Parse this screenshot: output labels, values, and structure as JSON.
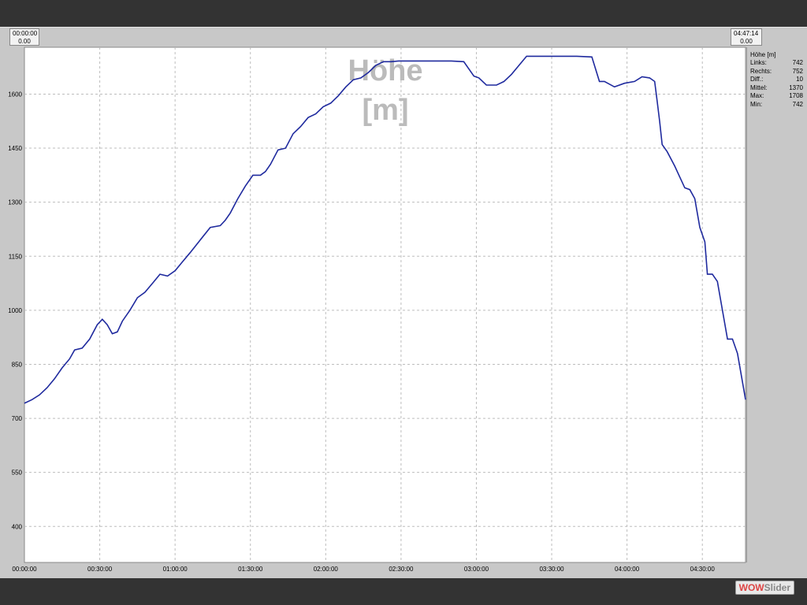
{
  "cursors": {
    "left": {
      "time": "00:00:00",
      "value": "0.00"
    },
    "right": {
      "time": "04:47:14",
      "value": "0.00"
    }
  },
  "stats": {
    "title": "Höhe [m]",
    "rows": [
      {
        "label": "Links:",
        "value": "742"
      },
      {
        "label": "Rechts:",
        "value": "752"
      },
      {
        "label": "Diff.:",
        "value": "10"
      },
      {
        "label": "Mittel:",
        "value": "1370"
      },
      {
        "label": "Max:",
        "value": "1708"
      },
      {
        "label": "Min:",
        "value": "742"
      }
    ]
  },
  "logo": {
    "part1": "WOW",
    "part2": "Slider"
  },
  "colors": {
    "line": "#1f2a9e",
    "grid": "#bdbdbd",
    "watermark": "#bbbbbb"
  },
  "chart_data": {
    "type": "line",
    "title": "Höhe [m]",
    "xlabel": "",
    "ylabel": "",
    "x_unit": "minutes",
    "xlim": [
      0,
      287.2
    ],
    "ylim": [
      300,
      1730
    ],
    "yticks": [
      400,
      550,
      700,
      850,
      1000,
      1150,
      1300,
      1450,
      1600
    ],
    "xticks": [
      {
        "v": 0,
        "label": "00:00:00"
      },
      {
        "v": 30,
        "label": "00:30:00"
      },
      {
        "v": 60,
        "label": "01:00:00"
      },
      {
        "v": 90,
        "label": "01:30:00"
      },
      {
        "v": 120,
        "label": "02:00:00"
      },
      {
        "v": 150,
        "label": "02:30:00"
      },
      {
        "v": 180,
        "label": "03:00:00"
      },
      {
        "v": 210,
        "label": "03:30:00"
      },
      {
        "v": 240,
        "label": "04:00:00"
      },
      {
        "v": 270,
        "label": "04:30:00"
      }
    ],
    "grid": true,
    "series": [
      {
        "name": "Höhe",
        "x": [
          0,
          3,
          6,
          9,
          12,
          15,
          18,
          20,
          23,
          26,
          29,
          31,
          33,
          35,
          37,
          39,
          42,
          45,
          48,
          51,
          54,
          57,
          60,
          63,
          66,
          70,
          74,
          78,
          80,
          82,
          85,
          88,
          91,
          94,
          96,
          98,
          101,
          104,
          107,
          110,
          113,
          116,
          119,
          122,
          125,
          128,
          131,
          134,
          137,
          140,
          143,
          146,
          149,
          152,
          155,
          160,
          165,
          170,
          175,
          179,
          181,
          184,
          188,
          191,
          194,
          197,
          200,
          203,
          206,
          210,
          215,
          220,
          226,
          229,
          231,
          235,
          239,
          243,
          246,
          249,
          251,
          252,
          253,
          254,
          256,
          259,
          261,
          263,
          265,
          267,
          269,
          271,
          272,
          274,
          276,
          278,
          280,
          282,
          284,
          286,
          287.2
        ],
        "values": [
          742,
          752,
          765,
          785,
          810,
          840,
          865,
          890,
          895,
          920,
          960,
          975,
          960,
          935,
          940,
          970,
          1000,
          1035,
          1050,
          1075,
          1100,
          1095,
          1110,
          1135,
          1160,
          1195,
          1230,
          1235,
          1250,
          1270,
          1310,
          1345,
          1375,
          1375,
          1385,
          1405,
          1445,
          1450,
          1490,
          1510,
          1535,
          1545,
          1565,
          1575,
          1595,
          1620,
          1640,
          1645,
          1660,
          1680,
          1690,
          1690,
          1692,
          1692,
          1692,
          1692,
          1692,
          1692,
          1690,
          1650,
          1645,
          1625,
          1625,
          1635,
          1655,
          1680,
          1705,
          1705,
          1705,
          1705,
          1705,
          1705,
          1703,
          1635,
          1635,
          1620,
          1630,
          1635,
          1648,
          1645,
          1635,
          1580,
          1525,
          1460,
          1440,
          1400,
          1370,
          1340,
          1335,
          1310,
          1230,
          1190,
          1100,
          1100,
          1080,
          1000,
          920,
          920,
          880,
          800,
          752
        ]
      }
    ]
  }
}
